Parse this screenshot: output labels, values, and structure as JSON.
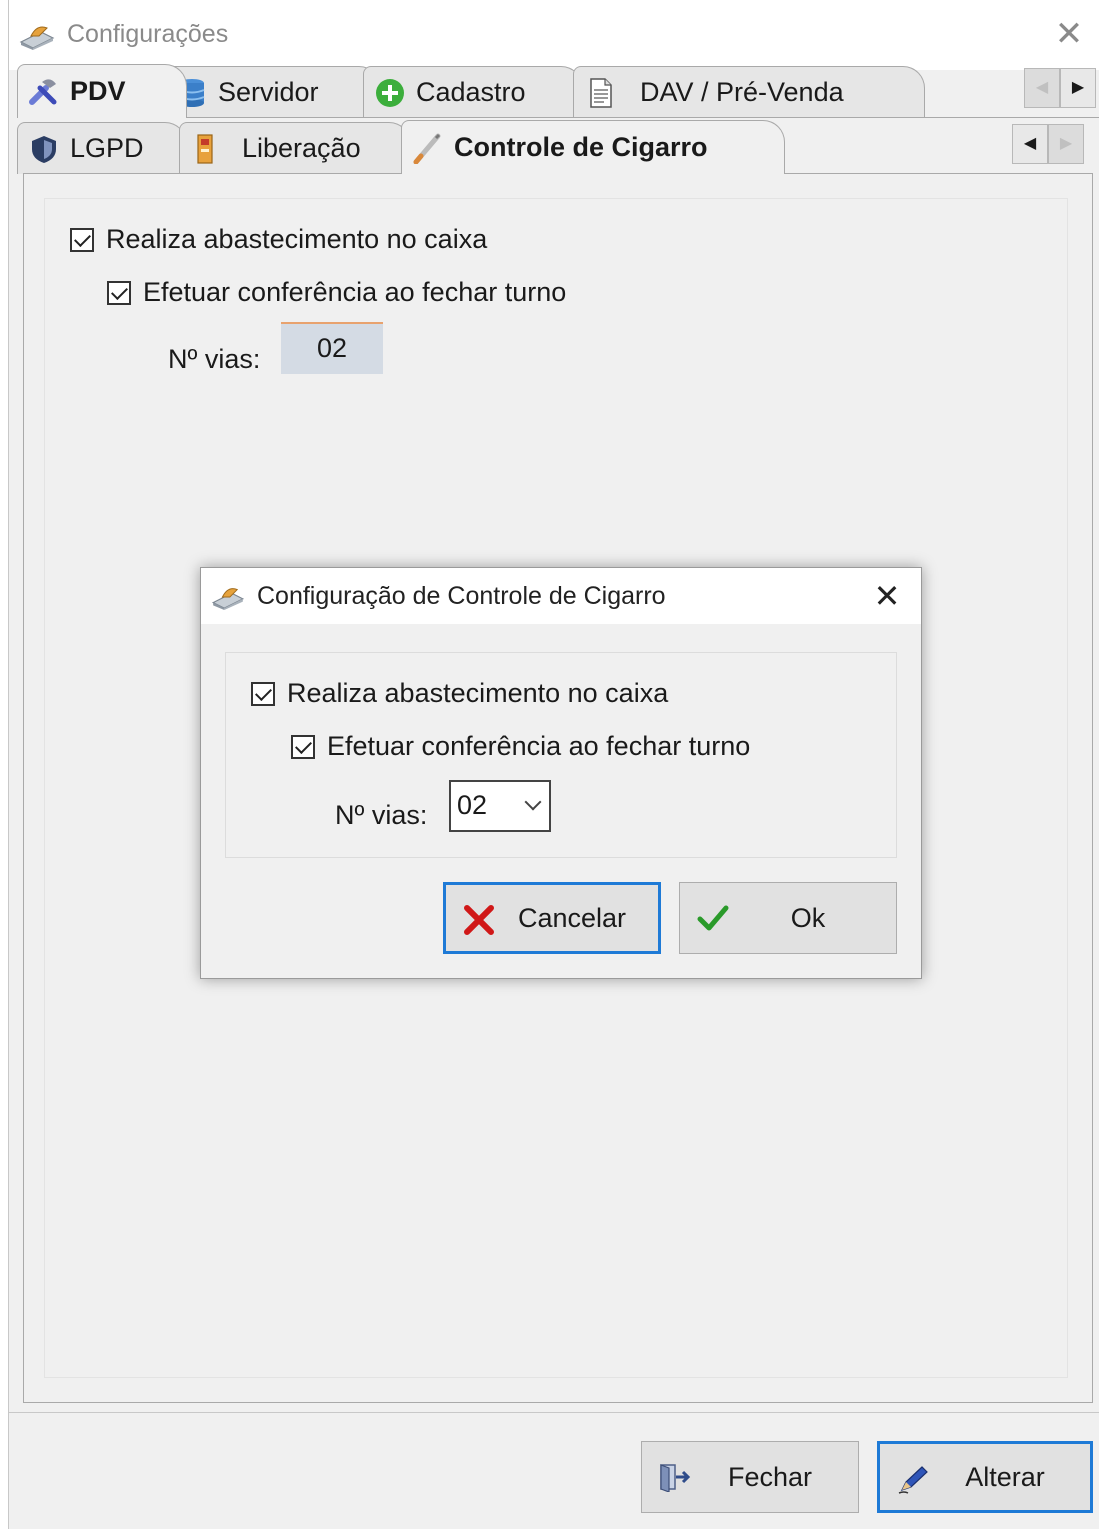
{
  "window": {
    "title": "Configurações",
    "close_glyph": "✕"
  },
  "tabs_row1": [
    {
      "label": "PDV",
      "icon": "tools-icon",
      "active": true
    },
    {
      "label": "Servidor",
      "icon": "database-icon"
    },
    {
      "label": "Cadastro",
      "icon": "plus-circle-icon"
    },
    {
      "label": "DAV / Pré-Venda",
      "icon": "document-icon"
    }
  ],
  "tabs_row2": [
    {
      "label": "LGPD",
      "icon": "shield-icon"
    },
    {
      "label": "Liberação",
      "icon": "release-icon"
    },
    {
      "label": "Controle de Cigarro",
      "icon": "cigarette-icon",
      "active": true
    }
  ],
  "scroll": {
    "left": "◀",
    "right": "▶"
  },
  "main": {
    "check_abastecimento": "Realiza abastecimento no caixa",
    "check_conferencia": "Efetuar conferência ao fechar turno",
    "vias_label": "Nº vias:",
    "vias_value": "02"
  },
  "dialog": {
    "title": "Configuração de Controle de Cigarro",
    "close_glyph": "✕",
    "check_abastecimento": "Realiza abastecimento no caixa",
    "check_conferencia": "Efetuar conferência ao fechar turno",
    "vias_label": "Nº vias:",
    "vias_value": "02",
    "cancel_label": "Cancelar",
    "ok_label": "Ok"
  },
  "footer": {
    "close_label": "Fechar",
    "edit_label": "Alterar"
  },
  "colors": {
    "focus_border": "#1e7ad6",
    "cancel_red": "#d01818",
    "ok_green": "#2a9a2a",
    "vias_bg": "#d4dbe4"
  }
}
